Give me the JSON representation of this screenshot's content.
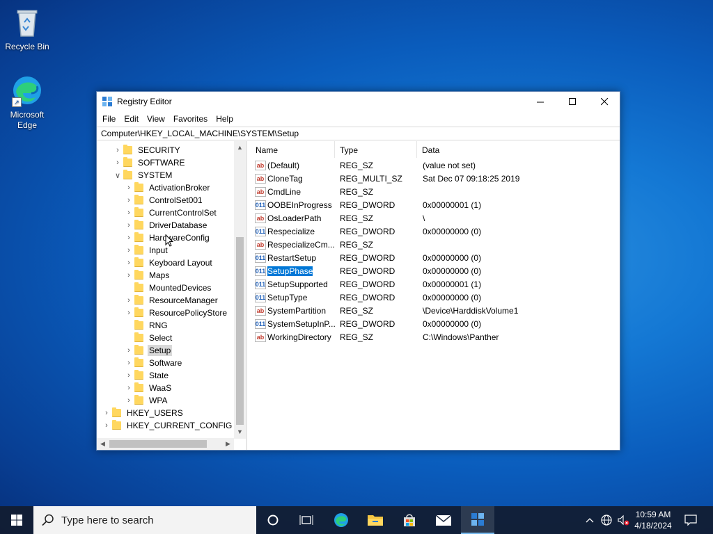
{
  "desktop": {
    "icons": [
      {
        "label": "Recycle Bin",
        "icon": "recycle-bin-icon"
      },
      {
        "label": "Microsoft Edge",
        "icon": "edge-icon"
      }
    ]
  },
  "window": {
    "title": "Registry Editor",
    "menu": [
      "File",
      "Edit",
      "View",
      "Favorites",
      "Help"
    ],
    "address": "Computer\\HKEY_LOCAL_MACHINE\\SYSTEM\\Setup",
    "tree": [
      {
        "label": "SECURITY",
        "level": 1,
        "state": "collapsed"
      },
      {
        "label": "SOFTWARE",
        "level": 1,
        "state": "collapsed"
      },
      {
        "label": "SYSTEM",
        "level": 1,
        "state": "expanded"
      },
      {
        "label": "ActivationBroker",
        "level": 2,
        "state": "collapsed"
      },
      {
        "label": "ControlSet001",
        "level": 2,
        "state": "collapsed"
      },
      {
        "label": "CurrentControlSet",
        "level": 2,
        "state": "collapsed"
      },
      {
        "label": "DriverDatabase",
        "level": 2,
        "state": "collapsed"
      },
      {
        "label": "HardwareConfig",
        "level": 2,
        "state": "collapsed"
      },
      {
        "label": "Input",
        "level": 2,
        "state": "collapsed"
      },
      {
        "label": "Keyboard Layout",
        "level": 2,
        "state": "collapsed"
      },
      {
        "label": "Maps",
        "level": 2,
        "state": "collapsed"
      },
      {
        "label": "MountedDevices",
        "level": 2,
        "state": "none"
      },
      {
        "label": "ResourceManager",
        "level": 2,
        "state": "collapsed"
      },
      {
        "label": "ResourcePolicyStore",
        "level": 2,
        "state": "collapsed"
      },
      {
        "label": "RNG",
        "level": 2,
        "state": "none"
      },
      {
        "label": "Select",
        "level": 2,
        "state": "none"
      },
      {
        "label": "Setup",
        "level": 2,
        "state": "collapsed",
        "selected": true
      },
      {
        "label": "Software",
        "level": 2,
        "state": "collapsed"
      },
      {
        "label": "State",
        "level": 2,
        "state": "collapsed"
      },
      {
        "label": "WaaS",
        "level": 2,
        "state": "collapsed"
      },
      {
        "label": "WPA",
        "level": 2,
        "state": "collapsed"
      },
      {
        "label": "HKEY_USERS",
        "level": 0,
        "state": "collapsed"
      },
      {
        "label": "HKEY_CURRENT_CONFIG",
        "level": 0,
        "state": "collapsed"
      }
    ],
    "columns": [
      "Name",
      "Type",
      "Data"
    ],
    "values": [
      {
        "name": "(Default)",
        "type": "REG_SZ",
        "data": "(value not set)",
        "kind": "sz"
      },
      {
        "name": "CloneTag",
        "type": "REG_MULTI_SZ",
        "data": "Sat Dec 07 09:18:25 2019",
        "kind": "sz"
      },
      {
        "name": "CmdLine",
        "type": "REG_SZ",
        "data": "",
        "kind": "sz"
      },
      {
        "name": "OOBEInProgress",
        "type": "REG_DWORD",
        "data": "0x00000001 (1)",
        "kind": "dw"
      },
      {
        "name": "OsLoaderPath",
        "type": "REG_SZ",
        "data": "\\",
        "kind": "sz"
      },
      {
        "name": "Respecialize",
        "type": "REG_DWORD",
        "data": "0x00000000 (0)",
        "kind": "dw"
      },
      {
        "name": "RespecializeCm...",
        "type": "REG_SZ",
        "data": "",
        "kind": "sz"
      },
      {
        "name": "RestartSetup",
        "type": "REG_DWORD",
        "data": "0x00000000 (0)",
        "kind": "dw"
      },
      {
        "name": "SetupPhase",
        "type": "REG_DWORD",
        "data": "0x00000000 (0)",
        "kind": "dw",
        "selected": true
      },
      {
        "name": "SetupSupported",
        "type": "REG_DWORD",
        "data": "0x00000001 (1)",
        "kind": "dw"
      },
      {
        "name": "SetupType",
        "type": "REG_DWORD",
        "data": "0x00000000 (0)",
        "kind": "dw"
      },
      {
        "name": "SystemPartition",
        "type": "REG_SZ",
        "data": "\\Device\\HarddiskVolume1",
        "kind": "sz"
      },
      {
        "name": "SystemSetupInP...",
        "type": "REG_DWORD",
        "data": "0x00000000 (0)",
        "kind": "dw"
      },
      {
        "name": "WorkingDirectory",
        "type": "REG_SZ",
        "data": "C:\\Windows\\Panther",
        "kind": "sz"
      }
    ]
  },
  "taskbar": {
    "search_placeholder": "Type here to search",
    "time": "10:59 AM",
    "date": "4/18/2024"
  },
  "icon_glyphs": {
    "sz": "ab",
    "dw": "011"
  },
  "colors": {
    "accent": "#0078d7",
    "folder": "#ffd75f"
  }
}
